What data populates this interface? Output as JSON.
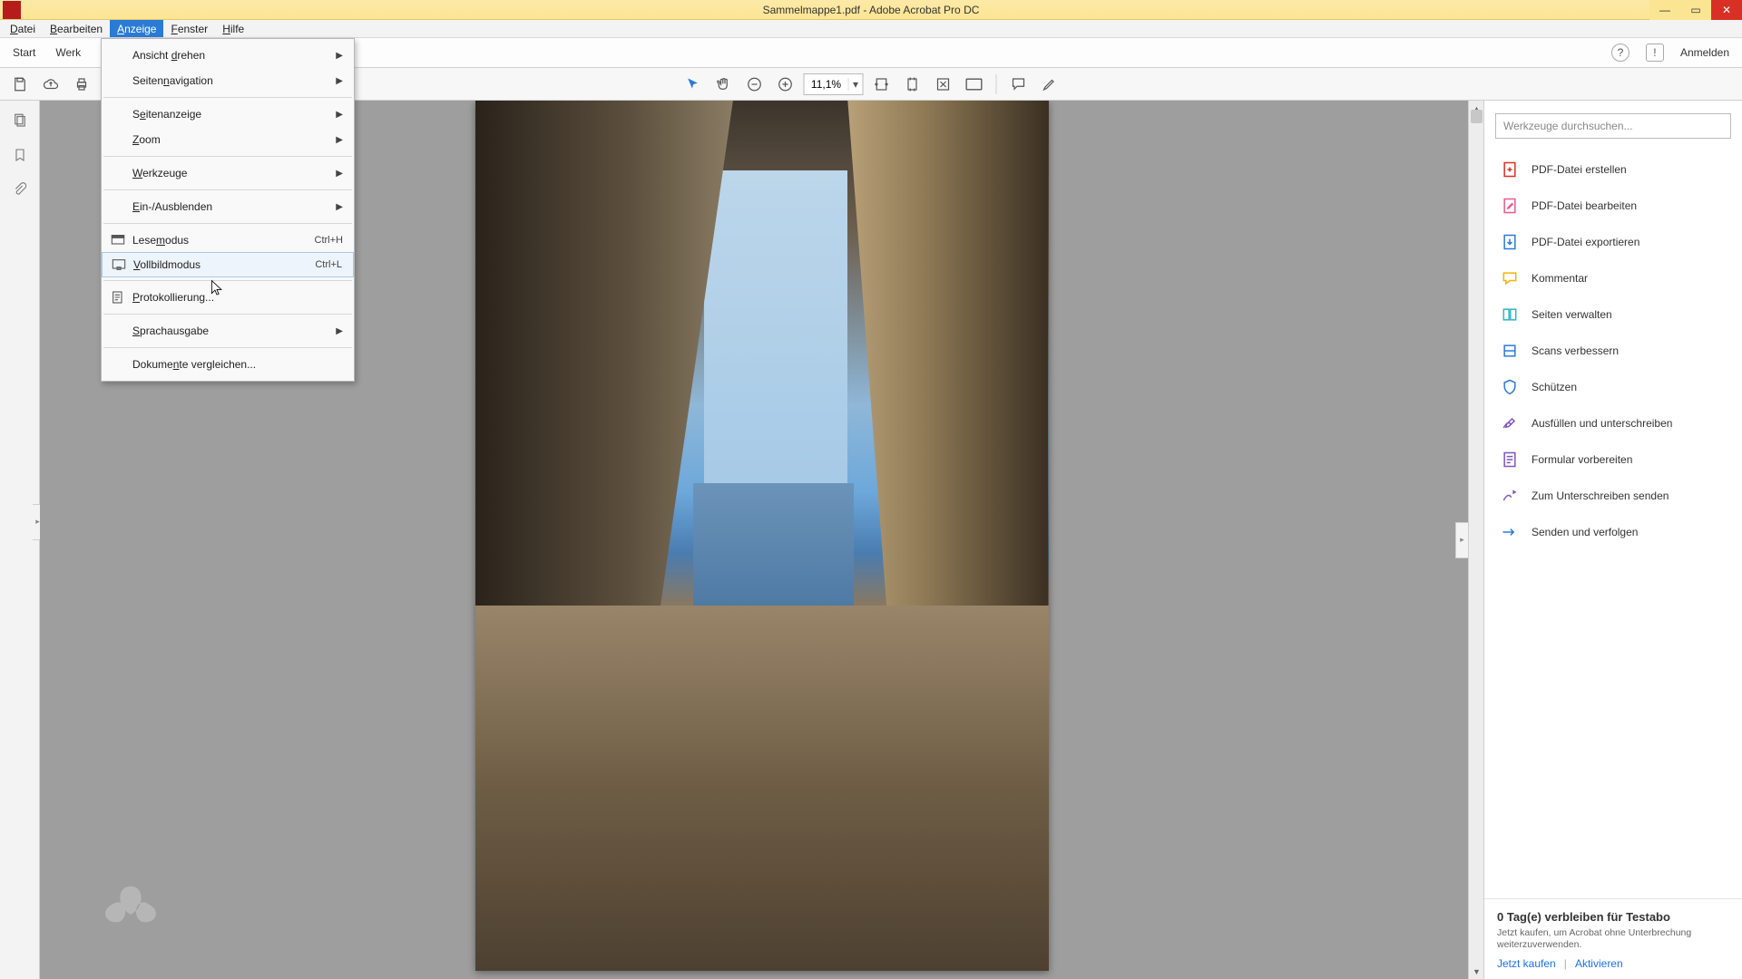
{
  "title": "Sammelmappe1.pdf - Adobe Acrobat Pro DC",
  "menubar": [
    "Datei",
    "Bearbeiten",
    "Anzeige",
    "Fenster",
    "Hilfe"
  ],
  "menubar_active_index": 2,
  "secbar": {
    "start": "Start",
    "tools": "Werkzeuge",
    "login": "Anmelden"
  },
  "toolbar": {
    "zoom": "11,1%"
  },
  "dropdown": {
    "group1": [
      {
        "label": "Ansicht drehen",
        "u": 8,
        "submenu": true
      },
      {
        "label": "Seitennavigation",
        "u": 6,
        "submenu": true
      }
    ],
    "group2": [
      {
        "label": "Seitenanzeige",
        "u": 1,
        "submenu": true
      },
      {
        "label": "Zoom",
        "u": 0,
        "submenu": true
      }
    ],
    "group3": [
      {
        "label": "Werkzeuge",
        "u": 0,
        "submenu": true
      }
    ],
    "group4": [
      {
        "label": "Ein-/Ausblenden",
        "u": 0,
        "submenu": true
      }
    ],
    "group5": [
      {
        "label": "Lesemodus",
        "u": 4,
        "shortcut": "Ctrl+H",
        "icon": "read"
      },
      {
        "label": "Vollbildmodus",
        "u": 0,
        "shortcut": "Ctrl+L",
        "icon": "full",
        "hover": true
      }
    ],
    "group6": [
      {
        "label": "Protokollierung...",
        "u": 0,
        "icon": "log"
      }
    ],
    "group7": [
      {
        "label": "Sprachausgabe",
        "u": 0,
        "submenu": true
      }
    ],
    "group8": [
      {
        "label": "Dokumente vergleichen...",
        "u": 6
      }
    ]
  },
  "rpanel": {
    "search_placeholder": "Werkzeuge durchsuchen...",
    "tools": [
      {
        "label": "PDF-Datei erstellen",
        "color": "#d93025",
        "icon": "create"
      },
      {
        "label": "PDF-Datei bearbeiten",
        "color": "#e75a8d",
        "icon": "edit"
      },
      {
        "label": "PDF-Datei exportieren",
        "color": "#2a7bd6",
        "icon": "export"
      },
      {
        "label": "Kommentar",
        "color": "#f4b400",
        "icon": "comment"
      },
      {
        "label": "Seiten verwalten",
        "color": "#2fb5c4",
        "icon": "pages"
      },
      {
        "label": "Scans verbessern",
        "color": "#2a7bd6",
        "icon": "scan"
      },
      {
        "label": "Schützen",
        "color": "#2a7bd6",
        "icon": "protect"
      },
      {
        "label": "Ausfüllen und unterschreiben",
        "color": "#7e57c2",
        "icon": "fillsign"
      },
      {
        "label": "Formular vorbereiten",
        "color": "#7e57c2",
        "icon": "form"
      },
      {
        "label": "Zum Unterschreiben senden",
        "color": "#7e57c2",
        "icon": "sendsign"
      },
      {
        "label": "Senden und verfolgen",
        "color": "#2a7bd6",
        "icon": "sendtrack"
      }
    ]
  },
  "trial": {
    "title": "0 Tag(e) verbleiben für Testabo",
    "sub": "Jetzt kaufen, um Acrobat ohne Unterbrechung weiterzuverwenden.",
    "buy": "Jetzt kaufen",
    "activate": "Aktivieren"
  }
}
